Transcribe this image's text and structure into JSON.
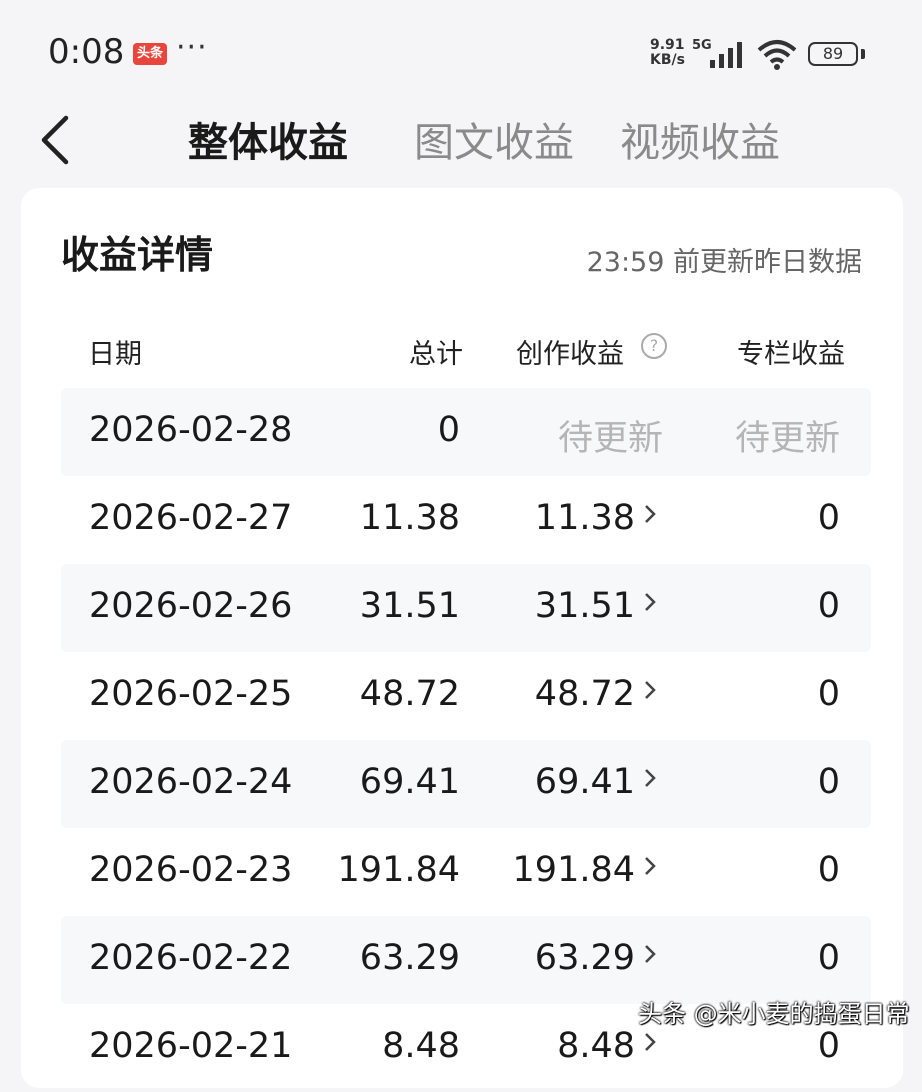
{
  "status_bar": {
    "time": "0:08",
    "app_badge": "头条",
    "more": "···",
    "net_speed_value": "9.91",
    "net_speed_unit": "KB/s",
    "net_type": "5G",
    "battery": "89"
  },
  "nav": {
    "tabs": [
      {
        "label": "整体收益",
        "active": true
      },
      {
        "label": "图文收益",
        "active": false
      },
      {
        "label": "视频收益",
        "active": false
      }
    ]
  },
  "card": {
    "title": "收益详情",
    "update_note": "23:59 前更新昨日数据",
    "headers": {
      "date": "日期",
      "total": "总计",
      "creation": "创作收益",
      "column": "专栏收益"
    },
    "rows": [
      {
        "date": "2026-02-28",
        "total": "0",
        "creation": "待更新",
        "column": "待更新"
      },
      {
        "date": "2026-02-27",
        "total": "11.38",
        "creation": "11.38",
        "column": "0"
      },
      {
        "date": "2026-02-26",
        "total": "31.51",
        "creation": "31.51",
        "column": "0"
      },
      {
        "date": "2026-02-25",
        "total": "48.72",
        "creation": "48.72",
        "column": "0"
      },
      {
        "date": "2026-02-24",
        "total": "69.41",
        "creation": "69.41",
        "column": "0"
      },
      {
        "date": "2026-02-23",
        "total": "191.84",
        "creation": "191.84",
        "column": "0"
      },
      {
        "date": "2026-02-22",
        "total": "63.29",
        "creation": "63.29",
        "column": "0"
      },
      {
        "date": "2026-02-21",
        "total": "8.48",
        "creation": "8.48",
        "column": "0"
      }
    ]
  },
  "watermark": "头条 @米小麦的捣蛋日常"
}
